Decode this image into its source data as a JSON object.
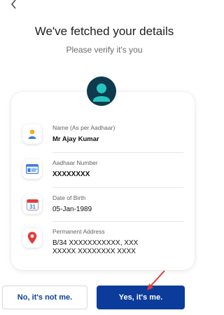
{
  "header": {
    "title": "We've fetched your details",
    "subtitle": "Please verify it's you"
  },
  "details": [
    {
      "label": "Name (As per Aadhaar)",
      "value": "Mr Ajay Kumar",
      "icon": "user-icon"
    },
    {
      "label": "Aadhaar Number",
      "value": "XXXXXXXX",
      "icon": "id-card-icon"
    },
    {
      "label": "Date of Birth",
      "value": "05-Jan-1989",
      "icon": "calendar-icon"
    },
    {
      "label": "Permanent Address",
      "value_lines": [
        "B/34 XXXXXXXXXXX, XXX",
        "XXXXX XXXXXXXX XXXX"
      ],
      "icon": "location-pin-icon"
    }
  ],
  "calendar_day": "31",
  "buttons": {
    "no_label": "No, it's not me.",
    "yes_label": "Yes, it's me."
  },
  "colors": {
    "primary": "#0b3c9c",
    "accent_red": "#e53935",
    "avatar_bg": "#0f3a4d",
    "avatar_face": "#26c6c0"
  }
}
